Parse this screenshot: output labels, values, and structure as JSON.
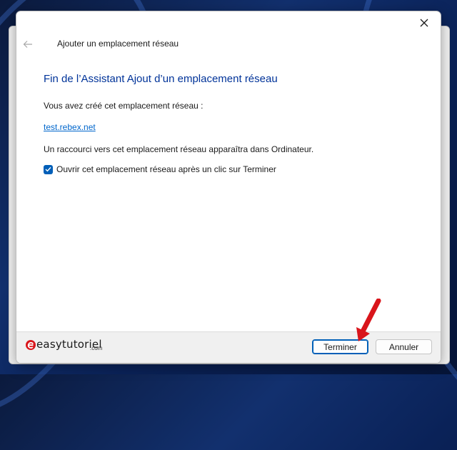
{
  "window": {
    "title": "Ajouter un emplacement réseau"
  },
  "content": {
    "heading": "Fin de l’Assistant Ajout d’un emplacement réseau",
    "intro": "Vous avez créé cet emplacement réseau :",
    "location": "test.rebex.net",
    "shortcut_info": "Un raccourci vers cet emplacement réseau apparaîtra dans Ordinateur.",
    "open_checkbox_label": "Ouvrir cet emplacement réseau après un clic sur Terminer",
    "open_checkbox_checked": true
  },
  "footer": {
    "logo_text": "easytutoriel",
    "logo_sub": ".com",
    "finish_label": "Terminer",
    "cancel_label": "Annuler"
  },
  "colors": {
    "heading": "#003399",
    "link": "#0066cc",
    "accent": "#005fb8",
    "arrow": "#d9151b"
  },
  "icons": {
    "close": "close-icon",
    "back": "back-arrow-icon",
    "check": "checkmark-icon",
    "logo": "easytutoriel-logo-icon",
    "pointer": "red-arrow-icon"
  }
}
